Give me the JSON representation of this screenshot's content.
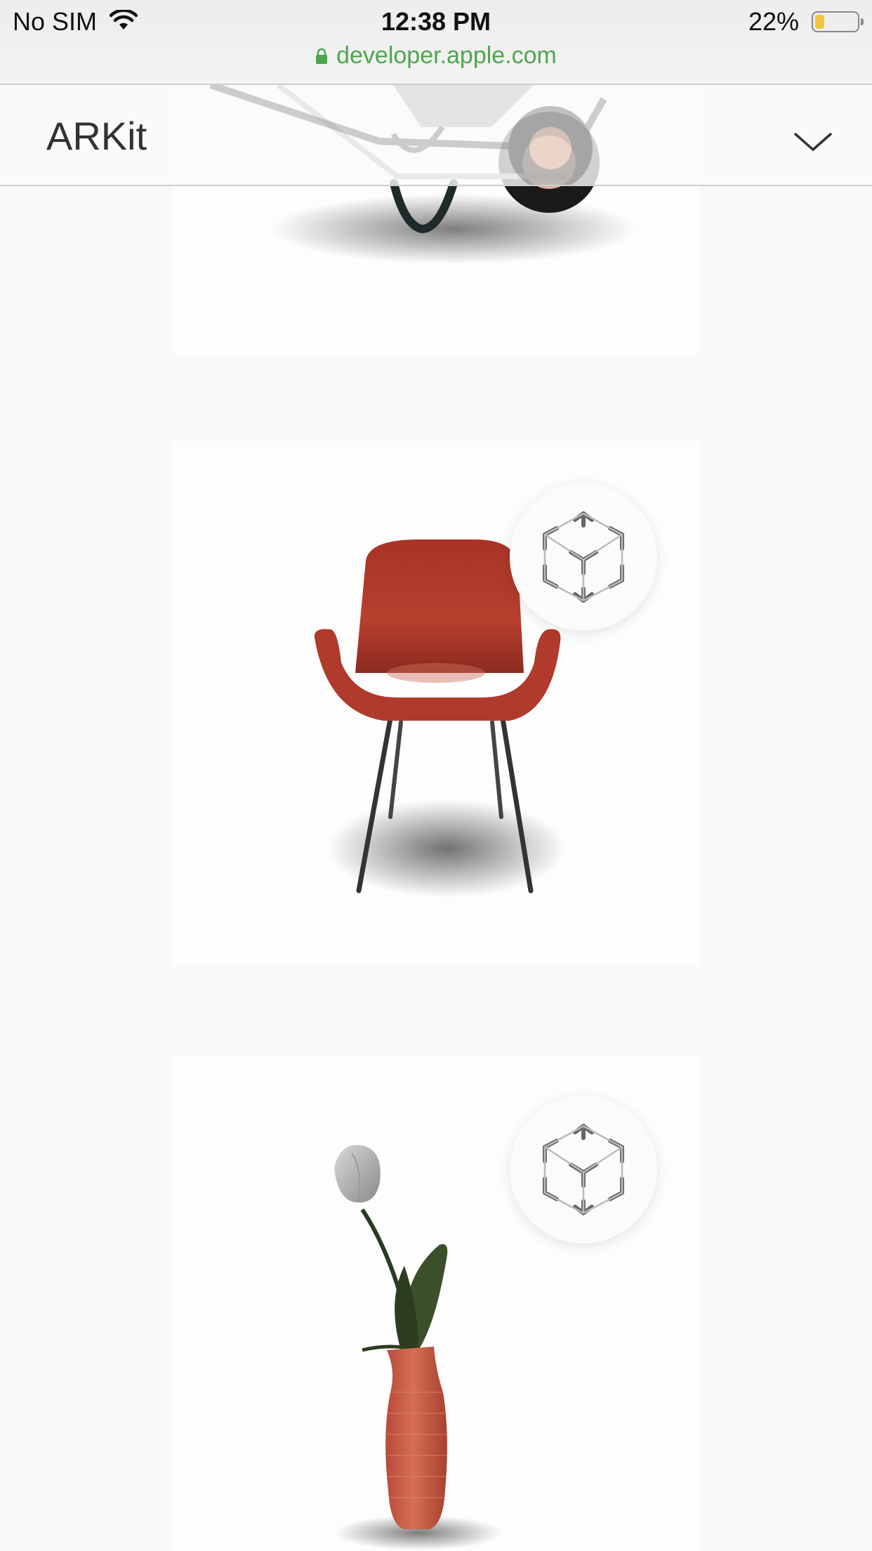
{
  "status_bar": {
    "carrier": "No SIM",
    "time": "12:38 PM",
    "battery_percent": "22%",
    "battery_level": 0.22,
    "url": "developer.apple.com",
    "url_color": "#4fa64f"
  },
  "nav": {
    "title": "ARKit",
    "menu_icon": "chevron-down-icon"
  },
  "models": [
    {
      "name": "wheelbarrow",
      "has_ar_button": false
    },
    {
      "name": "chair",
      "color": "#b23a2c",
      "ar_icon": "ar-cube-icon"
    },
    {
      "name": "tulip-vase",
      "vase_color": "#c85a40",
      "ar_icon": "ar-cube-icon"
    }
  ]
}
